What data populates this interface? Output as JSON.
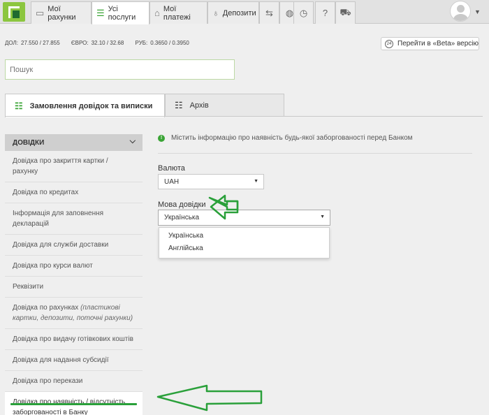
{
  "nav": {
    "tabs": [
      {
        "label": "Мої рахунки",
        "icon": "card-icon"
      },
      {
        "label": "Усі послуги",
        "icon": "list-icon",
        "active": true
      },
      {
        "label": "Мої платежі",
        "icon": "house-icon"
      },
      {
        "label": "Депозити",
        "icon": "money-bag-icon"
      }
    ],
    "icon_buttons": [
      "transport-icon",
      "globe-icon",
      "clock-icon",
      "help-icon",
      "cart-icon"
    ]
  },
  "rates": {
    "usd_label": "ДОЛ:",
    "usd_value": "27.550 / 27.855",
    "eur_label": "ЄВРО:",
    "eur_value": "32.10 / 32.68",
    "rub_label": "РУБ:",
    "rub_value": "0.3650 / 0.3950"
  },
  "beta": {
    "badge": "24",
    "label": "Перейти в «Beta» версію"
  },
  "search": {
    "placeholder": "Пошук"
  },
  "page_tabs": [
    {
      "label": "Замовлення довідок та виписки",
      "active": true
    },
    {
      "label": "Архів"
    }
  ],
  "sidebar": {
    "header": "ДОВІДКИ",
    "items": [
      {
        "text": "Довідка про закриття картки / рахунку"
      },
      {
        "text": "Довідка по кредитах"
      },
      {
        "text": "Інформація для заповнення декларацій"
      },
      {
        "text": "Довідка для служби доставки"
      },
      {
        "text": "Довідка про курси валют"
      },
      {
        "text": "Реквізити"
      },
      {
        "text": "Довідка по рахунках ",
        "note": "(пластикові картки, депозити, поточні рахунки)"
      },
      {
        "text": "Довідка про видачу готівкових коштів"
      },
      {
        "text": "Довідка для надання субсидії"
      },
      {
        "text": "Довідка про перекази"
      },
      {
        "text": "Довідка про наявність / відсутність заборгованості в Банку",
        "active": true
      }
    ]
  },
  "main": {
    "info_text": "Містить інформацію про наявність будь-якої заборгованості перед Банком",
    "currency_label": "Валюта",
    "currency_value": "UAH",
    "language_label": "Мова довідки",
    "language_value": "Українська",
    "language_options": [
      "Українська",
      "Англійська"
    ]
  },
  "colors": {
    "accent": "#3aa435",
    "brand": "#8cc63f",
    "annotation": "#2aa03a"
  }
}
